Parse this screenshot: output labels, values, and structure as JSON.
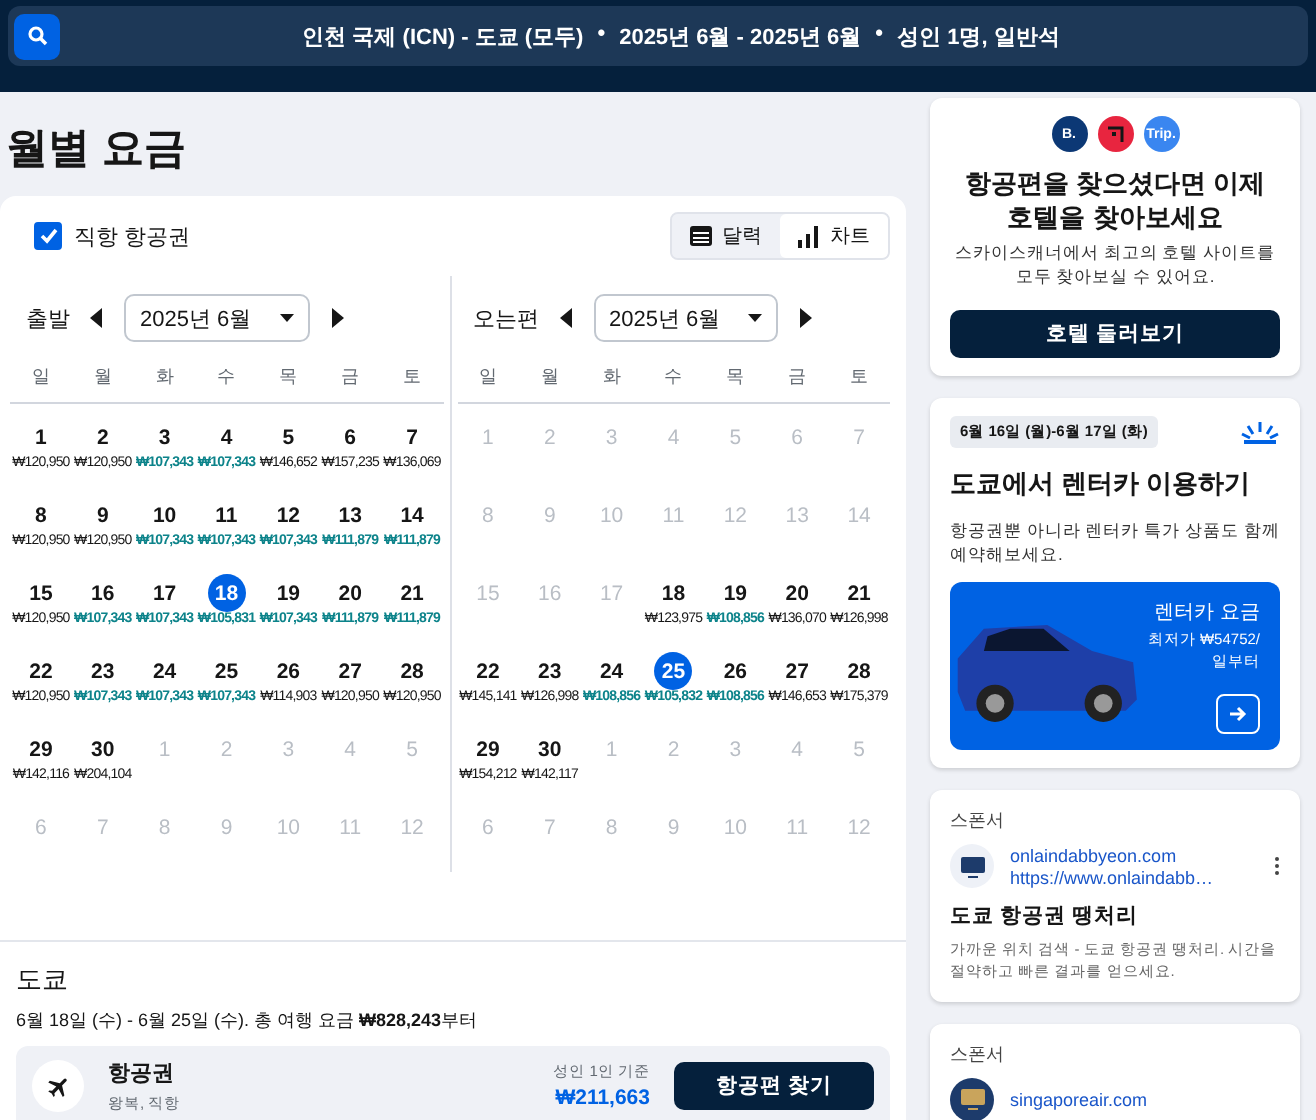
{
  "search_bar": {
    "segments": [
      "인천 국제 (ICN) - 도쿄 (모두)",
      "•",
      "2025년 6월 - 2025년 6월",
      "•",
      "성인 1명, 일반석"
    ]
  },
  "title": "월별 요금",
  "direct_only": {
    "label": "직항 항공권",
    "checked": true
  },
  "view_tabs": [
    {
      "label": "달력",
      "kind": "calendar",
      "selected": true
    },
    {
      "label": "차트",
      "kind": "chart",
      "selected": false
    }
  ],
  "calendars": [
    {
      "label": "출발",
      "month": "2025년 6월",
      "weekdays": [
        "일",
        "월",
        "화",
        "수",
        "목",
        "금",
        "토"
      ],
      "weeks": [
        [
          {
            "day": "1",
            "price": "₩120,950",
            "cheap": false,
            "faded": false,
            "selected": false
          },
          {
            "day": "2",
            "price": "₩120,950",
            "cheap": false,
            "faded": false,
            "selected": false
          },
          {
            "day": "3",
            "price": "₩107,343",
            "cheap": true,
            "faded": false,
            "selected": false
          },
          {
            "day": "4",
            "price": "₩107,343",
            "cheap": true,
            "faded": false,
            "selected": false
          },
          {
            "day": "5",
            "price": "₩146,652",
            "cheap": false,
            "faded": false,
            "selected": false
          },
          {
            "day": "6",
            "price": "₩157,235",
            "cheap": false,
            "faded": false,
            "selected": false
          },
          {
            "day": "7",
            "price": "₩136,069",
            "cheap": false,
            "faded": false,
            "selected": false
          }
        ],
        [
          {
            "day": "8",
            "price": "₩120,950",
            "cheap": false,
            "faded": false,
            "selected": false
          },
          {
            "day": "9",
            "price": "₩120,950",
            "cheap": false,
            "faded": false,
            "selected": false
          },
          {
            "day": "10",
            "price": "₩107,343",
            "cheap": true,
            "faded": false,
            "selected": false
          },
          {
            "day": "11",
            "price": "₩107,343",
            "cheap": true,
            "faded": false,
            "selected": false
          },
          {
            "day": "12",
            "price": "₩107,343",
            "cheap": true,
            "faded": false,
            "selected": false
          },
          {
            "day": "13",
            "price": "₩111,879",
            "cheap": true,
            "faded": false,
            "selected": false
          },
          {
            "day": "14",
            "price": "₩111,879",
            "cheap": true,
            "faded": false,
            "selected": false
          }
        ],
        [
          {
            "day": "15",
            "price": "₩120,950",
            "cheap": false,
            "faded": false,
            "selected": false
          },
          {
            "day": "16",
            "price": "₩107,343",
            "cheap": true,
            "faded": false,
            "selected": false
          },
          {
            "day": "17",
            "price": "₩107,343",
            "cheap": true,
            "faded": false,
            "selected": false
          },
          {
            "day": "18",
            "price": "₩105,831",
            "cheap": true,
            "faded": false,
            "selected": true
          },
          {
            "day": "19",
            "price": "₩107,343",
            "cheap": true,
            "faded": false,
            "selected": false
          },
          {
            "day": "20",
            "price": "₩111,879",
            "cheap": true,
            "faded": false,
            "selected": false
          },
          {
            "day": "21",
            "price": "₩111,879",
            "cheap": true,
            "faded": false,
            "selected": false
          }
        ],
        [
          {
            "day": "22",
            "price": "₩120,950",
            "cheap": false,
            "faded": false,
            "selected": false
          },
          {
            "day": "23",
            "price": "₩107,343",
            "cheap": true,
            "faded": false,
            "selected": false
          },
          {
            "day": "24",
            "price": "₩107,343",
            "cheap": true,
            "faded": false,
            "selected": false
          },
          {
            "day": "25",
            "price": "₩107,343",
            "cheap": true,
            "faded": false,
            "selected": false
          },
          {
            "day": "26",
            "price": "₩114,903",
            "cheap": false,
            "faded": false,
            "selected": false
          },
          {
            "day": "27",
            "price": "₩120,950",
            "cheap": false,
            "faded": false,
            "selected": false
          },
          {
            "day": "28",
            "price": "₩120,950",
            "cheap": false,
            "faded": false,
            "selected": false
          }
        ],
        [
          {
            "day": "29",
            "price": "₩142,116",
            "cheap": false,
            "faded": false,
            "selected": false
          },
          {
            "day": "30",
            "price": "₩204,104",
            "cheap": false,
            "faded": false,
            "selected": false
          },
          {
            "day": "1",
            "faded": true,
            "selected": false
          },
          {
            "day": "2",
            "faded": true,
            "selected": false
          },
          {
            "day": "3",
            "faded": true,
            "selected": false
          },
          {
            "day": "4",
            "faded": true,
            "selected": false
          },
          {
            "day": "5",
            "faded": true,
            "selected": false
          }
        ],
        [
          {
            "day": "6",
            "faded": true,
            "selected": false
          },
          {
            "day": "7",
            "faded": true,
            "selected": false
          },
          {
            "day": "8",
            "faded": true,
            "selected": false
          },
          {
            "day": "9",
            "faded": true,
            "selected": false
          },
          {
            "day": "10",
            "faded": true,
            "selected": false
          },
          {
            "day": "11",
            "faded": true,
            "selected": false
          },
          {
            "day": "12",
            "faded": true,
            "selected": false
          }
        ]
      ]
    },
    {
      "label": "오는편",
      "month": "2025년 6월",
      "weekdays": [
        "일",
        "월",
        "화",
        "수",
        "목",
        "금",
        "토"
      ],
      "weeks": [
        [
          {
            "day": "1",
            "faded": true,
            "selected": false
          },
          {
            "day": "2",
            "faded": true,
            "selected": false
          },
          {
            "day": "3",
            "faded": true,
            "selected": false
          },
          {
            "day": "4",
            "faded": true,
            "selected": false
          },
          {
            "day": "5",
            "faded": true,
            "selected": false
          },
          {
            "day": "6",
            "faded": true,
            "selected": false
          },
          {
            "day": "7",
            "faded": true,
            "selected": false
          }
        ],
        [
          {
            "day": "8",
            "faded": true,
            "selected": false
          },
          {
            "day": "9",
            "faded": true,
            "selected": false
          },
          {
            "day": "10",
            "faded": true,
            "selected": false
          },
          {
            "day": "11",
            "faded": true,
            "selected": false
          },
          {
            "day": "12",
            "faded": true,
            "selected": false
          },
          {
            "day": "13",
            "faded": true,
            "selected": false
          },
          {
            "day": "14",
            "faded": true,
            "selected": false
          }
        ],
        [
          {
            "day": "15",
            "faded": true,
            "selected": false
          },
          {
            "day": "16",
            "faded": true,
            "selected": false
          },
          {
            "day": "17",
            "faded": true,
            "selected": false
          },
          {
            "day": "18",
            "price": "₩123,975",
            "cheap": false,
            "faded": false,
            "selected": false
          },
          {
            "day": "19",
            "price": "₩108,856",
            "cheap": true,
            "faded": false,
            "selected": false
          },
          {
            "day": "20",
            "price": "₩136,070",
            "cheap": false,
            "faded": false,
            "selected": false
          },
          {
            "day": "21",
            "price": "₩126,998",
            "cheap": false,
            "faded": false,
            "selected": false
          }
        ],
        [
          {
            "day": "22",
            "price": "₩145,141",
            "cheap": false,
            "faded": false,
            "selected": false
          },
          {
            "day": "23",
            "price": "₩126,998",
            "cheap": false,
            "faded": false,
            "selected": false
          },
          {
            "day": "24",
            "price": "₩108,856",
            "cheap": true,
            "faded": false,
            "selected": false
          },
          {
            "day": "25",
            "price": "₩105,832",
            "cheap": true,
            "faded": false,
            "selected": true
          },
          {
            "day": "26",
            "price": "₩108,856",
            "cheap": true,
            "faded": false,
            "selected": false
          },
          {
            "day": "27",
            "price": "₩146,653",
            "cheap": false,
            "faded": false,
            "selected": false
          },
          {
            "day": "28",
            "price": "₩175,379",
            "cheap": false,
            "faded": false,
            "selected": false
          }
        ],
        [
          {
            "day": "29",
            "price": "₩154,212",
            "cheap": false,
            "faded": false,
            "selected": false
          },
          {
            "day": "30",
            "price": "₩142,117",
            "cheap": false,
            "faded": false,
            "selected": false
          },
          {
            "day": "1",
            "faded": true,
            "selected": false
          },
          {
            "day": "2",
            "faded": true,
            "selected": false
          },
          {
            "day": "3",
            "faded": true,
            "selected": false
          },
          {
            "day": "4",
            "faded": true,
            "selected": false
          },
          {
            "day": "5",
            "faded": true,
            "selected": false
          }
        ],
        [
          {
            "day": "6",
            "faded": true,
            "selected": false
          },
          {
            "day": "7",
            "faded": true,
            "selected": false
          },
          {
            "day": "8",
            "faded": true,
            "selected": false
          },
          {
            "day": "9",
            "faded": true,
            "selected": false
          },
          {
            "day": "10",
            "faded": true,
            "selected": false
          },
          {
            "day": "11",
            "faded": true,
            "selected": false
          },
          {
            "day": "12",
            "faded": true,
            "selected": false
          }
        ]
      ]
    }
  ],
  "destination": {
    "name": "도쿄",
    "summary": "6월 18일 (수) - 6월 25일 (수). 총 여행 요금 **₩828,243**부터",
    "offer": {
      "title": "항공권",
      "subtitle": "왕복, 직항",
      "note": "성인 1인 기준",
      "price": "₩211,663",
      "button": "항공편 찾기"
    }
  },
  "hotel_card": {
    "logos": [
      {
        "kind": "text",
        "text": "B.",
        "color": "#0c3875"
      },
      {
        "kind": "icon",
        "color": "#e8253f"
      },
      {
        "kind": "text",
        "text": "Trip.",
        "color": "#3a86f0"
      }
    ],
    "title": "항공편을 찾으셨다면 이제 호텔을 찾아보세요",
    "text": "스카이스캐너에서 최고의 호텔 사이트를 모두 찾아보실 수 있어요.",
    "button": "호텔 둘러보기"
  },
  "car_card": {
    "dates": "6월 16일 (월)-6월 17일 (화)",
    "title": "도쿄에서 렌터카 이용하기",
    "text": "항공권뿐 아니라 렌터카 특가 상품도 함께 예약해보세요.",
    "promo_title": "렌터카 요금",
    "promo_price": "최저가 ₩54752/일부터"
  },
  "sponsors": [
    {
      "label": "스폰서",
      "domain": "onlaindabbyeon.com",
      "url": "https://www.onlaindabb…",
      "title": "도쿄 항공권 땡처리",
      "text": "가까운 위치 검색 - 도쿄 항공권 땡처리. 시간을 절약하고 빠른 결과를 얻으세요."
    },
    {
      "label": "스폰서",
      "domain": "singaporeair.com"
    }
  ]
}
